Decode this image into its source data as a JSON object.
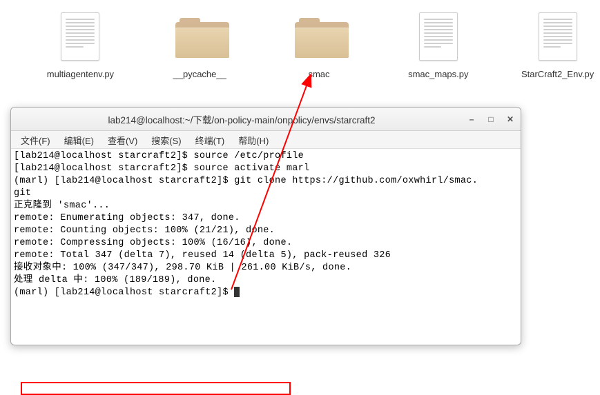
{
  "desktop": {
    "items": [
      {
        "label": "multiagentenv.py",
        "type": "file"
      },
      {
        "label": "__pycache__",
        "type": "folder"
      },
      {
        "label": "smac",
        "type": "folder"
      },
      {
        "label": "smac_maps.py",
        "type": "file"
      },
      {
        "label": "StarCraft2_Env.py",
        "type": "file"
      }
    ]
  },
  "terminal": {
    "title": "lab214@localhost:~/下载/on-policy-main/onpolicy/envs/starcraft2",
    "menu": {
      "file": "文件(F)",
      "edit": "编辑(E)",
      "view": "查看(V)",
      "search": "搜索(S)",
      "terminal": "终端(T)",
      "help": "帮助(H)"
    },
    "lines": {
      "l0": "[lab214@localhost starcraft2]$ source /etc/profile",
      "l1": "[lab214@localhost starcraft2]$ source activate marl",
      "l2": "(marl) [lab214@localhost starcraft2]$ git clone https://github.com/oxwhirl/smac.",
      "l3": "git",
      "l4": "正克隆到 'smac'...",
      "l5": "remote: Enumerating objects: 347, done.",
      "l6": "remote: Counting objects: 100% (21/21), done.",
      "l7": "remote: Compressing objects: 100% (16/16), done.",
      "l8": "remote: Total 347 (delta 7), reused 14 (delta 5), pack-reused 326",
      "l9": "接收对象中: 100% (347/347), 298.70 KiB | 261.00 KiB/s, done.",
      "l10": "处理 delta 中: 100% (189/189), done.",
      "l11": "(marl) [lab214@localhost starcraft2]$ "
    }
  },
  "annotation": {
    "highlight_color": "#ff0000",
    "arrow_color": "#ff0000"
  }
}
